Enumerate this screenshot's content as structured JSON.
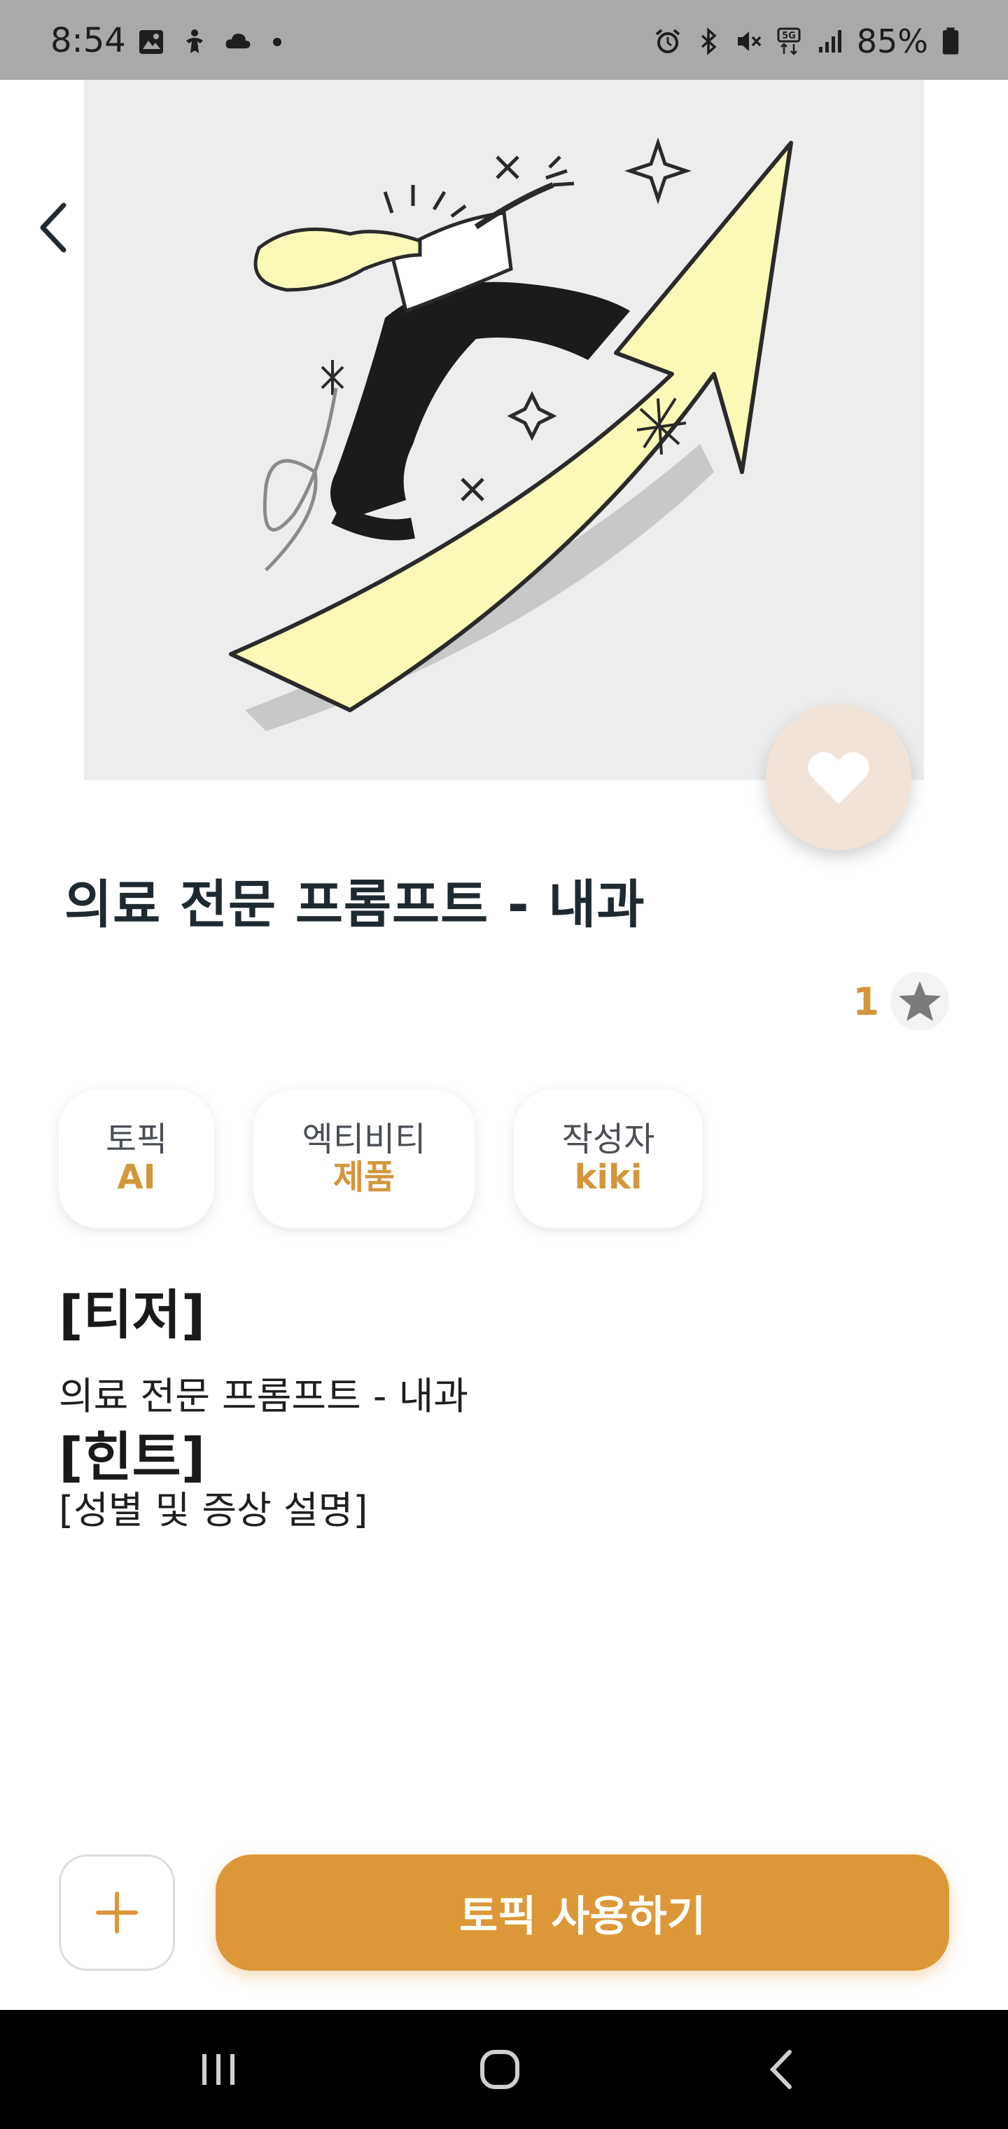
{
  "status_bar": {
    "time": "8:54",
    "battery": "85%",
    "left_icons": [
      "gallery-icon",
      "accessibility-icon",
      "cloud-icon",
      "dot-icon"
    ],
    "right_icons": [
      "alarm-icon",
      "bluetooth-icon",
      "mute-icon",
      "5g-icon",
      "signal-icon",
      "battery-icon"
    ]
  },
  "header": {
    "back_icon": "chevron-left-icon",
    "like_icon": "heart-icon"
  },
  "detail": {
    "title": "의료 전문 프롬프트 - 내과",
    "rating_count": "1",
    "rating_icon": "star-icon"
  },
  "chips": [
    {
      "label": "토픽",
      "value": "AI"
    },
    {
      "label": "엑티비티",
      "value": "제품"
    },
    {
      "label": "작성자",
      "value": "kiki"
    }
  ],
  "description": {
    "teaser_heading": "[티저]",
    "teaser_text": "의료 전문 프롬프트 - 내과",
    "hint_heading": "[힌트]",
    "hint_text": "[성별 및 증상 설명]"
  },
  "actions": {
    "add_icon": "plus-icon",
    "use_label": "토픽 사용하기"
  },
  "colors": {
    "accent": "#dc9838",
    "accent_text": "#d4963a",
    "like_bg": "#f1e3d8",
    "illustration_yellow": "#fbf9b8"
  },
  "nav": [
    "recent-apps-icon",
    "home-icon",
    "back-icon"
  ]
}
